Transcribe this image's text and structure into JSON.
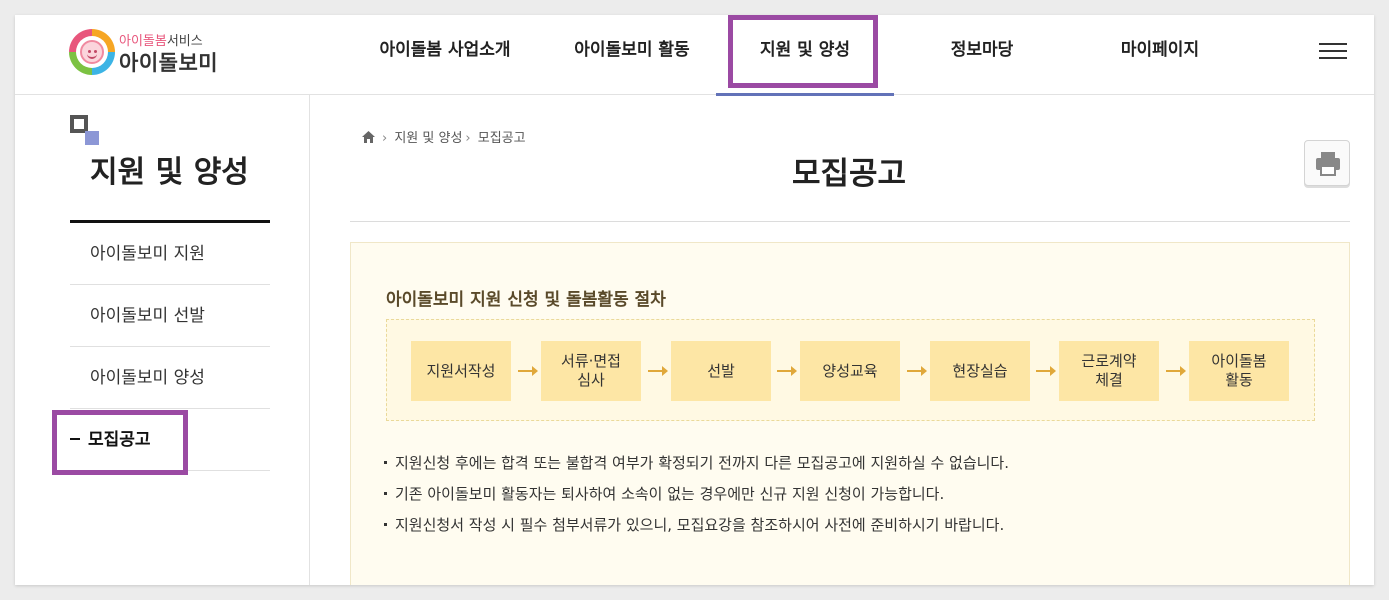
{
  "logo": {
    "sub_pink": "아이돌봄",
    "sub_dark": "서비스",
    "main": "아이돌보미"
  },
  "gnb": [
    {
      "label": "아이돌봄 사업소개"
    },
    {
      "label": "아이돌보미 활동"
    },
    {
      "label": "지원 및 양성",
      "active": true
    },
    {
      "label": "정보마당"
    },
    {
      "label": "마이페이지"
    }
  ],
  "sidebar": {
    "title": "지원 및 양성",
    "items": [
      {
        "label": "아이돌보미 지원"
      },
      {
        "label": "아이돌보미 선발"
      },
      {
        "label": "아이돌보미 양성"
      },
      {
        "label": "모집공고",
        "active": true
      }
    ]
  },
  "breadcrumb": {
    "items": [
      "지원 및 양성",
      "모집공고"
    ]
  },
  "page_title": "모집공고",
  "procedure": {
    "title": "아이돌보미 지원 신청 및 돌봄활동 절차",
    "steps": [
      {
        "line1": "지원서작성",
        "line2": ""
      },
      {
        "line1": "서류·면접",
        "line2": "심사"
      },
      {
        "line1": "선발",
        "line2": ""
      },
      {
        "line1": "양성교육",
        "line2": ""
      },
      {
        "line1": "현장실습",
        "line2": ""
      },
      {
        "line1": "근로계약",
        "line2": "체결"
      },
      {
        "line1": "아이돌봄",
        "line2": "활동"
      }
    ]
  },
  "notes": [
    "지원신청 후에는 합격 또는 불합격 여부가 확정되기 전까지 다른 모집공고에 지원하실 수 없습니다.",
    "기존 아이돌보미 활동자는 퇴사하여 소속이 없는 경우에만 신규 지원 신청이 가능합니다.",
    "지원신청서 작성 시 필수 첨부서류가 있으니, 모집요강을 참조하시어 사전에 준비하시기 바랍니다."
  ],
  "colors": {
    "highlight": "#9b4aa3",
    "active_underline": "#6272b8",
    "box_bg": "#fffcf0",
    "step_bg": "#fde6a5",
    "arrow": "#e0a83a"
  }
}
